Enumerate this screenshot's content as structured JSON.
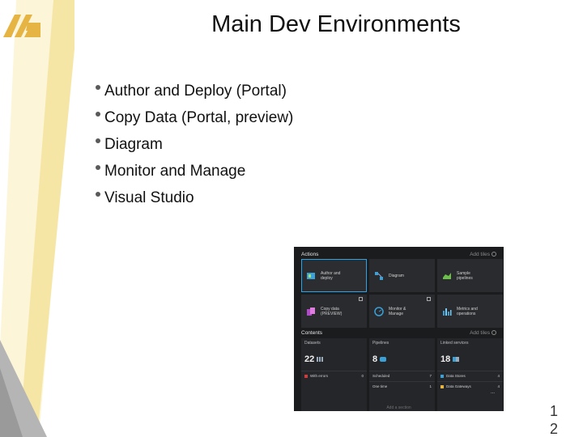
{
  "slide": {
    "title": "Main Dev Environments",
    "bullets": [
      "Author and Deploy (Portal)",
      "Copy Data (Portal, preview)",
      "Diagram",
      "Monitor and Manage",
      "Visual Studio"
    ],
    "page_number_line1": "1",
    "page_number_line2": "2"
  },
  "colors": {
    "band_light": "#fcf5d8",
    "band_gold": "#f0c35d",
    "band_gray": "#a9a9a9",
    "logo": "#e6b443",
    "portal_bg": "#1b1c1e",
    "selected_outline": "#2aa3e8"
  },
  "portal": {
    "actions_title": "Actions",
    "actions_add": "Add tiles",
    "actions": [
      {
        "label": "Author and deploy",
        "icon": "author-deploy-icon",
        "selected": true
      },
      {
        "label": "Diagram",
        "icon": "diagram-icon"
      },
      {
        "label": "Sample pipelines",
        "icon": "sample-pipelines-icon"
      },
      {
        "label": "Copy data (PREVIEW)",
        "icon": "copy-data-icon"
      },
      {
        "label": "Monitor & Manage",
        "icon": "monitor-manage-icon"
      },
      {
        "label": "Metrics and operations",
        "icon": "metrics-icon"
      }
    ],
    "contents_title": "Contents",
    "contents_add": "Add tiles",
    "contents": [
      {
        "header": "Datasets",
        "count": "22",
        "row1_label": "With errors",
        "row1_value": "0"
      },
      {
        "header": "Pipelines",
        "count": "8",
        "row1_label": "Scheduled",
        "row1_value": "7",
        "row2_label": "One time",
        "row2_value": "1"
      },
      {
        "header": "Linked services",
        "count": "18",
        "row1_label": "Data Stores",
        "row1_value": "4",
        "row2_label": "Data Gateways",
        "row2_value": "4",
        "more": "..."
      }
    ],
    "footer": "Add a section"
  }
}
